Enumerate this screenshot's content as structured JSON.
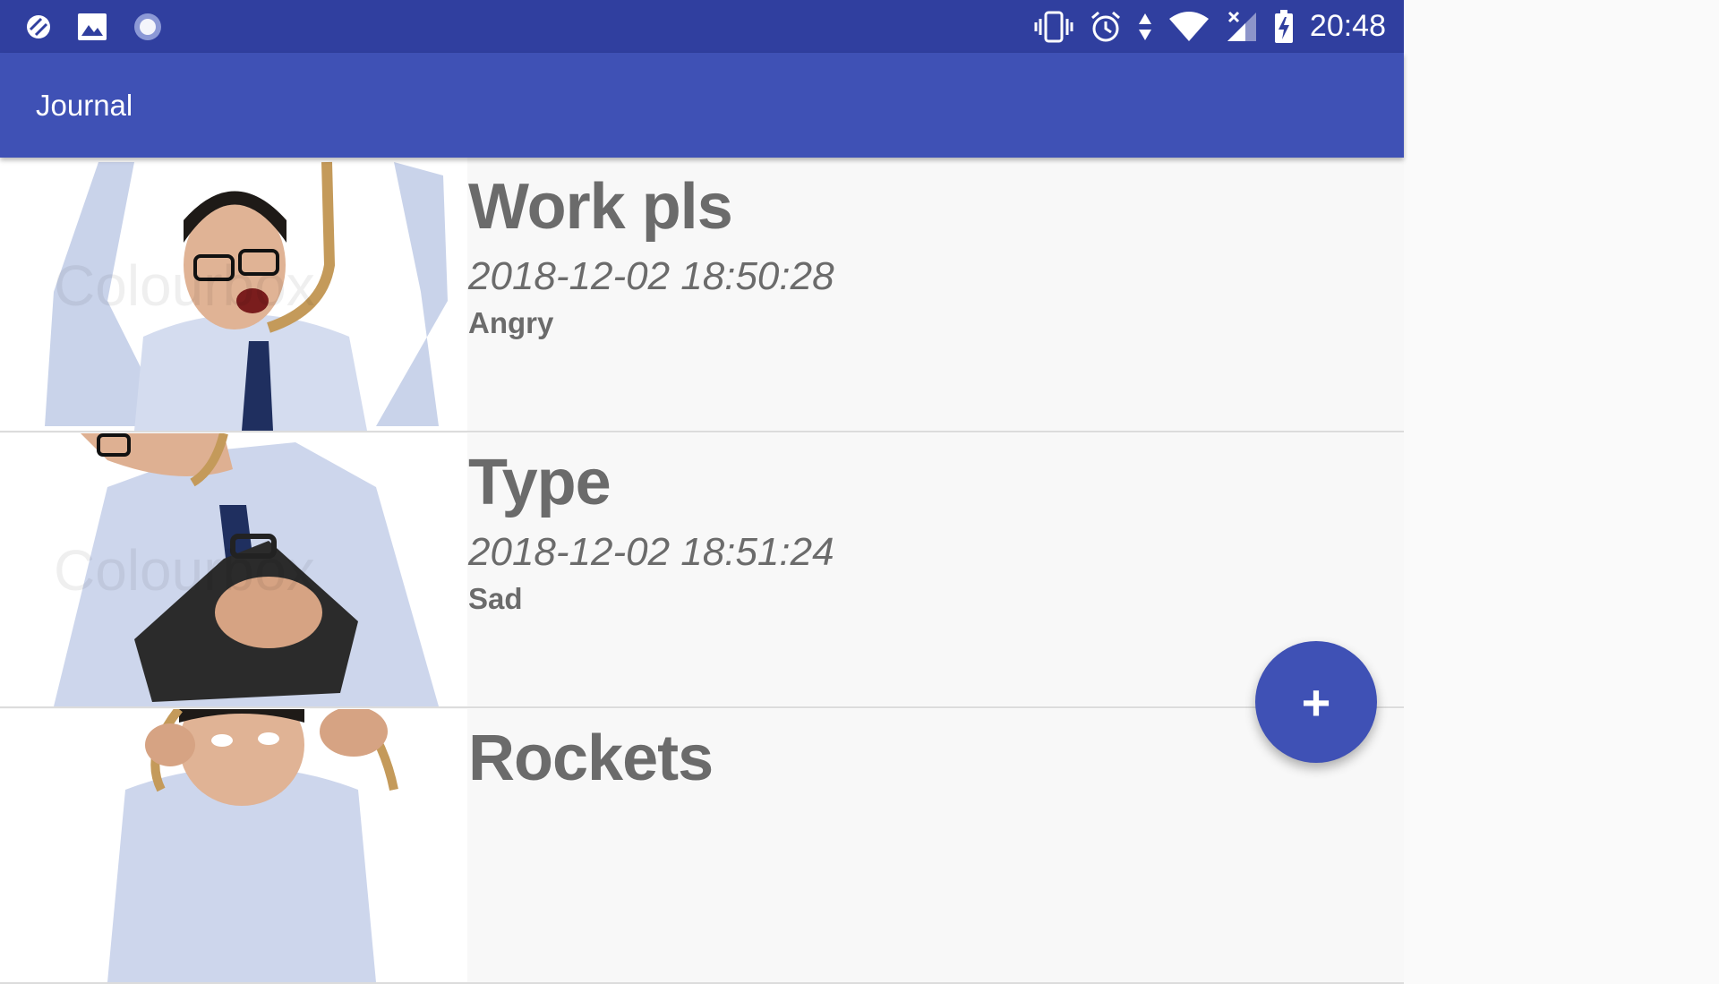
{
  "status_bar": {
    "time": "20:48",
    "left_icons": [
      "no-sync-icon",
      "image-icon",
      "loading-icon"
    ],
    "right_icons": [
      "vibrate-icon",
      "alarm-icon",
      "data-arrows-icon",
      "wifi-icon",
      "signal-no-service-icon",
      "battery-charging-icon"
    ],
    "background": "#303f9f"
  },
  "app_bar": {
    "title": "Journal",
    "background": "#3f51b5"
  },
  "entries": [
    {
      "title": "Work pls",
      "date": "2018-12-02 18:50:28",
      "mood": "Angry"
    },
    {
      "title": "Type",
      "date": "2018-12-02 18:51:24",
      "mood": "Sad"
    },
    {
      "title": "Rockets",
      "date": "",
      "mood": ""
    }
  ],
  "fab": {
    "label": "+",
    "icon": "add-icon",
    "color": "#3f51b5"
  },
  "colors": {
    "text_gray": "#6b6b6b",
    "accent": "#3f51b5",
    "status": "#303f9f"
  }
}
